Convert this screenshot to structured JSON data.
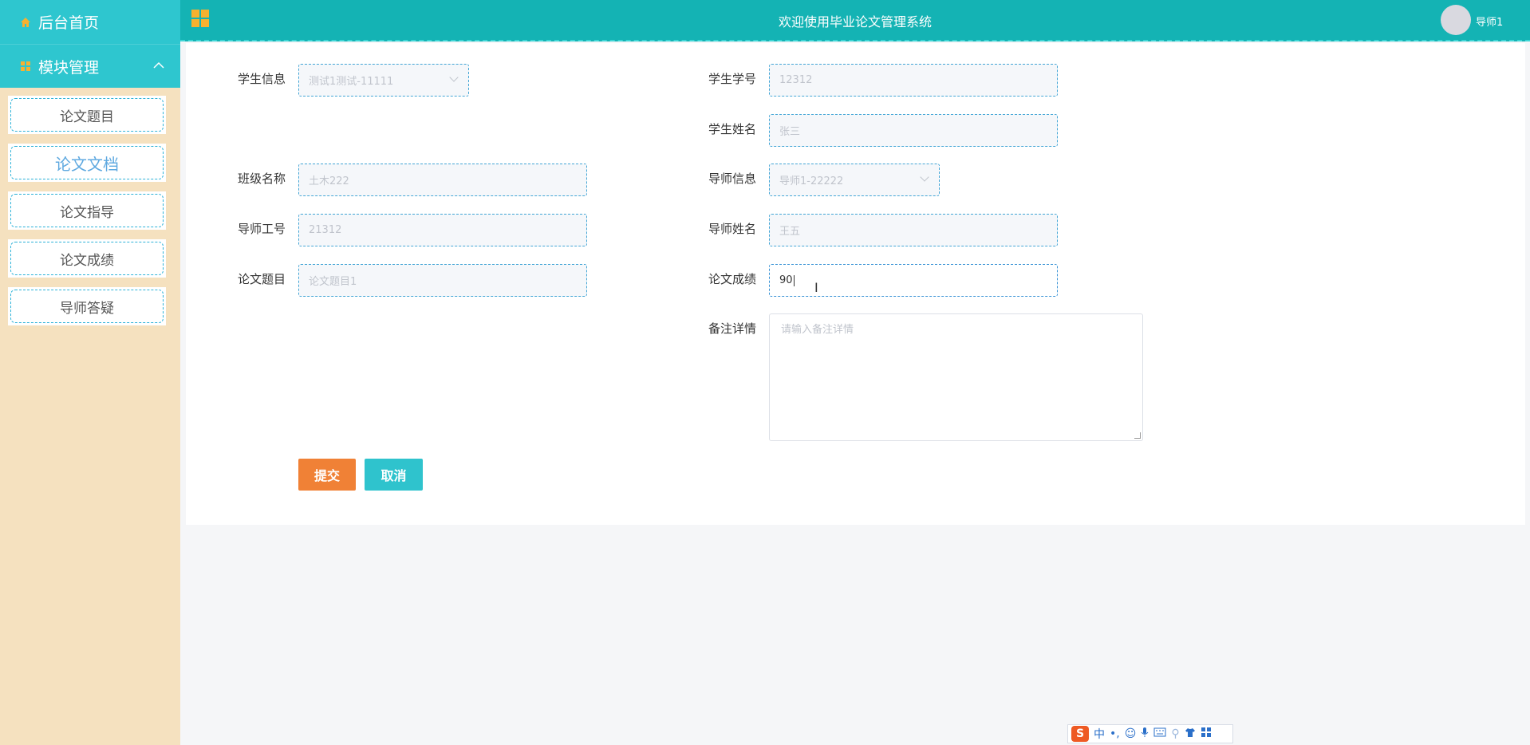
{
  "sidebar": {
    "home_label": "后台首页",
    "module_label": "模块管理",
    "items": [
      {
        "label": "论文题目"
      },
      {
        "label": "论文文档"
      },
      {
        "label": "论文指导"
      },
      {
        "label": "论文成绩"
      },
      {
        "label": "导师答疑"
      }
    ]
  },
  "header": {
    "title": "欢迎使用毕业论文管理系统",
    "user": "导师1"
  },
  "form": {
    "student_info": {
      "label": "学生信息",
      "value": "测试1测试-11111"
    },
    "student_no": {
      "label": "学生学号",
      "value": "12312"
    },
    "student_name": {
      "label": "学生姓名",
      "value": "张三"
    },
    "class_name": {
      "label": "班级名称",
      "value": "土木222"
    },
    "tutor_info": {
      "label": "导师信息",
      "value": "导师1-22222"
    },
    "tutor_no": {
      "label": "导师工号",
      "value": "21312"
    },
    "tutor_name": {
      "label": "导师姓名",
      "value": "王五"
    },
    "paper_title": {
      "label": "论文题目",
      "value": "论文题目1"
    },
    "paper_score": {
      "label": "论文成绩",
      "value": "90"
    },
    "remarks": {
      "label": "备注详情",
      "placeholder": "请输入备注详情"
    },
    "submit_label": "提交",
    "cancel_label": "取消"
  },
  "ime": {
    "logo": "S",
    "lang": "中",
    "punct": "•,",
    "icons": [
      "emoji-icon",
      "mic-icon",
      "keyboard-icon",
      "person-icon",
      "shirt-icon",
      "grid-icon"
    ]
  },
  "colors": {
    "header": "#14b3b4",
    "sidebar": "#f5e1bf",
    "sidebar_header": "#2ec6cf",
    "submit": "#f08136",
    "cancel": "#2fc3cd"
  }
}
